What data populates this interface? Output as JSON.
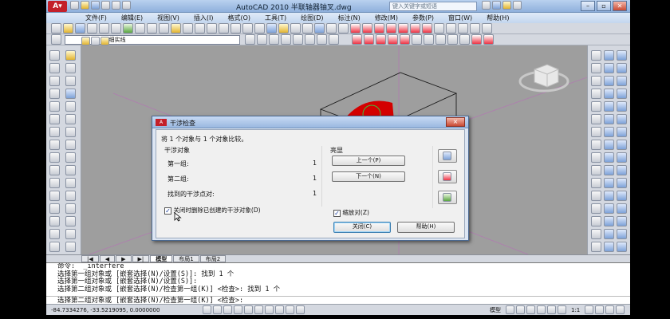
{
  "window": {
    "title": "AutoCAD 2010    半联轴器铀叉.dwg",
    "search_placeholder": "键入关键字或短语"
  },
  "menu": [
    "文件(F)",
    "编辑(E)",
    "视图(V)",
    "插入(I)",
    "格式(O)",
    "工具(T)",
    "绘图(D)",
    "标注(N)",
    "修改(M)",
    "参数(P)",
    "窗口(W)",
    "帮助(H)"
  ],
  "toolbar2": {
    "layer_name": "2细实线"
  },
  "tabs": [
    "模型",
    "布局1",
    "布局2"
  ],
  "command_lines": [
    "命令:  _interfere",
    "选择第一组对象或 [嵌套选择(N)/设置(S)]: 找到 1 个",
    "选择第一组对象或 [嵌套选择(N)/设置(S)]:",
    "选择第二组对象或 [嵌套选择(N)/检查第一组(K)] <检查>: 找到 1 个"
  ],
  "command_prompt": "选择第二组对象或 [嵌套选择(N)/检查第一组(K)] <检查>:",
  "status": {
    "coords": "-84.7334276, -33.5219095, 0.0000000",
    "model_label": "模型",
    "scale_label": "1:1"
  },
  "dialog": {
    "title": "干涉检查",
    "close_symbol": "×",
    "compare_message": "将 1 个对象与 1 个对象比较。",
    "interfering_group_title": "干涉对象",
    "rows": [
      {
        "label": "第一组:",
        "value": "1"
      },
      {
        "label": "第二组:",
        "value": "1"
      },
      {
        "label": "找到的干涉点对:",
        "value": "1"
      }
    ],
    "highlight_group_title": "亮显",
    "prev_button": "上一个(P)",
    "next_button": "下一个(N)",
    "zoom_pair_label": "缩放对(Z)",
    "zoom_pair_checked": true,
    "delete_on_close_label": "关闭时删除已创建的干涉对象(D)",
    "delete_on_close_checked": true,
    "close_button": "关闭(C)",
    "help_button": "帮助(H)"
  },
  "colors": {
    "viewport_bg": "#9e9e9e",
    "solid_red": "#d40000",
    "accent_blue": "#1a5fb4"
  }
}
